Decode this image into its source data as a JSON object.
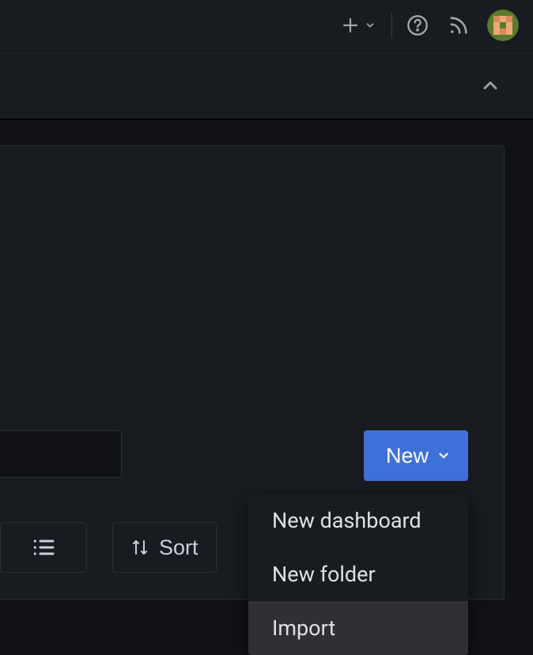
{
  "topbar": {
    "plus_icon": "plus-icon",
    "help_icon": "help-icon",
    "rss_icon": "rss-icon"
  },
  "new_button": {
    "label": "New"
  },
  "sort_button": {
    "label": "Sort"
  },
  "dropdown": {
    "items": [
      {
        "label": "New dashboard"
      },
      {
        "label": "New folder"
      },
      {
        "label": "Import"
      }
    ]
  }
}
